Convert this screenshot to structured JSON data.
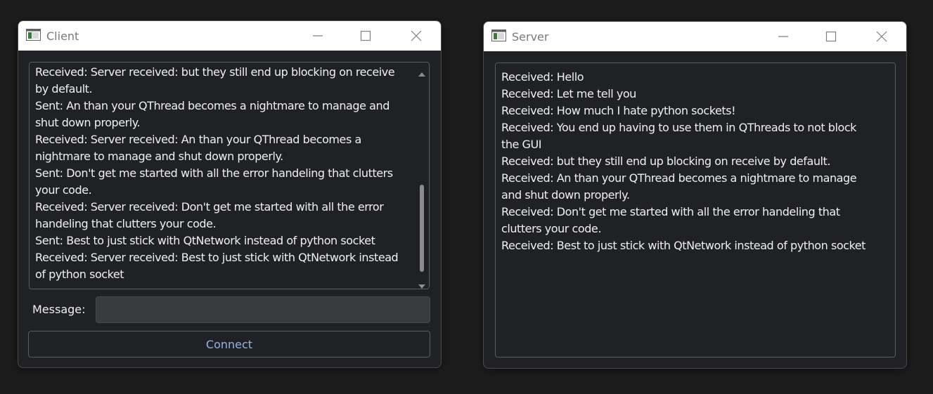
{
  "client": {
    "title": "Client",
    "log": [
      "Received: Server received: but they still end up blocking on receive",
      "by default.",
      "Sent: An than your QThread becomes a nightmare to manage and",
      "shut down properly.",
      "Received: Server received: An than your QThread becomes a",
      "nightmare to manage and shut down properly.",
      "Sent: Don't get me started with all the error handeling that clutters",
      "your code.",
      "Received: Server received: Don't get me started with all the error",
      "handeling that clutters your code.",
      "Sent: Best to just stick with QtNetwork instead of python socket",
      "Received: Server received: Best to just stick with QtNetwork instead",
      "of python socket"
    ],
    "message_label": "Message:",
    "message_value": "",
    "connect_label": "Connect"
  },
  "server": {
    "title": "Server",
    "log": [
      "Received: Hello",
      "Received: Let me tell you",
      "Received: How much I hate python sockets!",
      "Received: You end up having to use them in QThreads to not block",
      "the GUI",
      "Received: but they still end up blocking on receive by default.",
      "Received: An than your QThread becomes a nightmare to manage",
      "and shut down properly.",
      "Received: Don't get me started with all the error handeling that",
      "clutters your code.",
      "Received: Best to just stick with QtNetwork instead of python socket"
    ]
  },
  "icons": {
    "app": "app-window-icon",
    "minimize": "minimize-icon",
    "maximize": "maximize-icon",
    "close": "close-icon",
    "scroll_up": "scroll-up-arrow-icon",
    "scroll_down": "scroll-down-arrow-icon"
  },
  "colors": {
    "window_bg": "#202124",
    "titlebar_bg": "#ffffff",
    "text": "#f0f0f0",
    "connect_text": "#8fb5e8",
    "input_bg": "#3a3b3e"
  }
}
